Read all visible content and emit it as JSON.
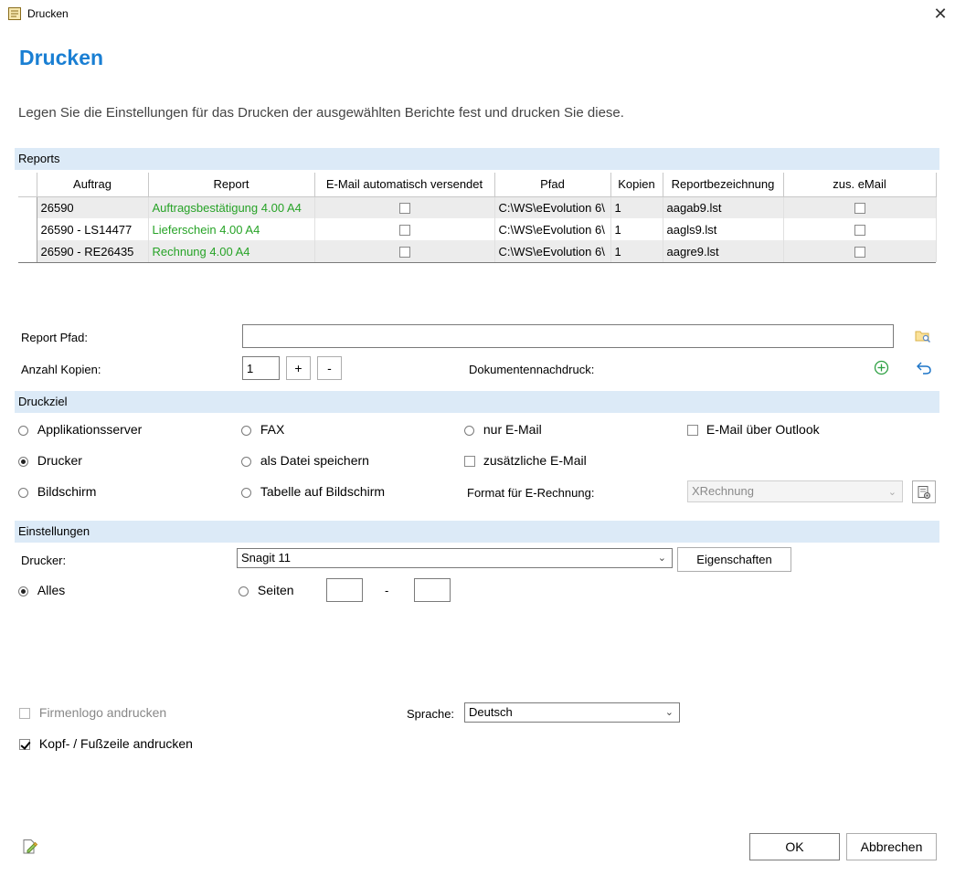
{
  "window": {
    "title": "Drucken",
    "close_glyph": "✕"
  },
  "header": {
    "title": "Drucken",
    "subtitle": "Legen Sie die Einstellungen für das Drucken der ausgewählten Berichte fest und drucken Sie diese."
  },
  "reports": {
    "section_label": "Reports",
    "columns": [
      "Auftrag",
      "Report",
      "E-Mail automatisch versendet",
      "Pfad",
      "Kopien",
      "Reportbezeichnung",
      "zus. eMail"
    ],
    "rows": [
      {
        "auftrag": "26590",
        "report": "Auftragsbestätigung 4.00 A4",
        "pfad": "C:\\WS\\eEvolution 6\\",
        "kopien": "1",
        "bezeichnung": "aagab9.lst"
      },
      {
        "auftrag": "26590 - LS14477",
        "report": "Lieferschein 4.00 A4",
        "pfad": "C:\\WS\\eEvolution 6\\",
        "kopien": "1",
        "bezeichnung": "aagls9.lst"
      },
      {
        "auftrag": "26590 - RE26435",
        "report": "Rechnung 4.00 A4",
        "pfad": "C:\\WS\\eEvolution 6\\",
        "kopien": "1",
        "bezeichnung": "aagre9.lst"
      }
    ]
  },
  "form": {
    "report_pfad_label": "Report Pfad:",
    "report_pfad_value": "",
    "anzahl_kopien_label": "Anzahl Kopien:",
    "anzahl_kopien_value": "1",
    "plus_label": "+",
    "minus_label": "-",
    "dokumentennachdruck_label": "Dokumentennachdruck:"
  },
  "druckziel": {
    "section_label": "Druckziel",
    "applikationsserver": "Applikationsserver",
    "drucker": "Drucker",
    "bildschirm": "Bildschirm",
    "fax": "FAX",
    "als_datei": "als Datei speichern",
    "tabelle": "Tabelle auf Bildschirm",
    "nur_email": "nur E-Mail",
    "zus_email": "zusätzliche E-Mail",
    "format_label": "Format für E-Rechnung:",
    "email_outlook": "E-Mail über Outlook",
    "format_value": "XRechnung"
  },
  "einstellungen": {
    "section_label": "Einstellungen",
    "drucker_label": "Drucker:",
    "drucker_value": "Snagit 11",
    "eigenschaften_label": "Eigenschaften",
    "alles_label": "Alles",
    "seiten_label": "Seiten",
    "seiten_from": "",
    "seiten_to": "",
    "range_sep": "-"
  },
  "options": {
    "firmenlogo": "Firmenlogo andrucken",
    "kopf_fuss": "Kopf- / Fußzeile andrucken",
    "sprache_label": "Sprache:",
    "sprache_value": "Deutsch"
  },
  "footer": {
    "ok": "OK",
    "abbrechen": "Abbrechen"
  },
  "colors": {
    "accent": "#1a7fd3",
    "section_bg": "#dceaf7",
    "report_green": "#27a327",
    "add_green": "#2ea043",
    "undo_blue": "#1a73c7"
  }
}
